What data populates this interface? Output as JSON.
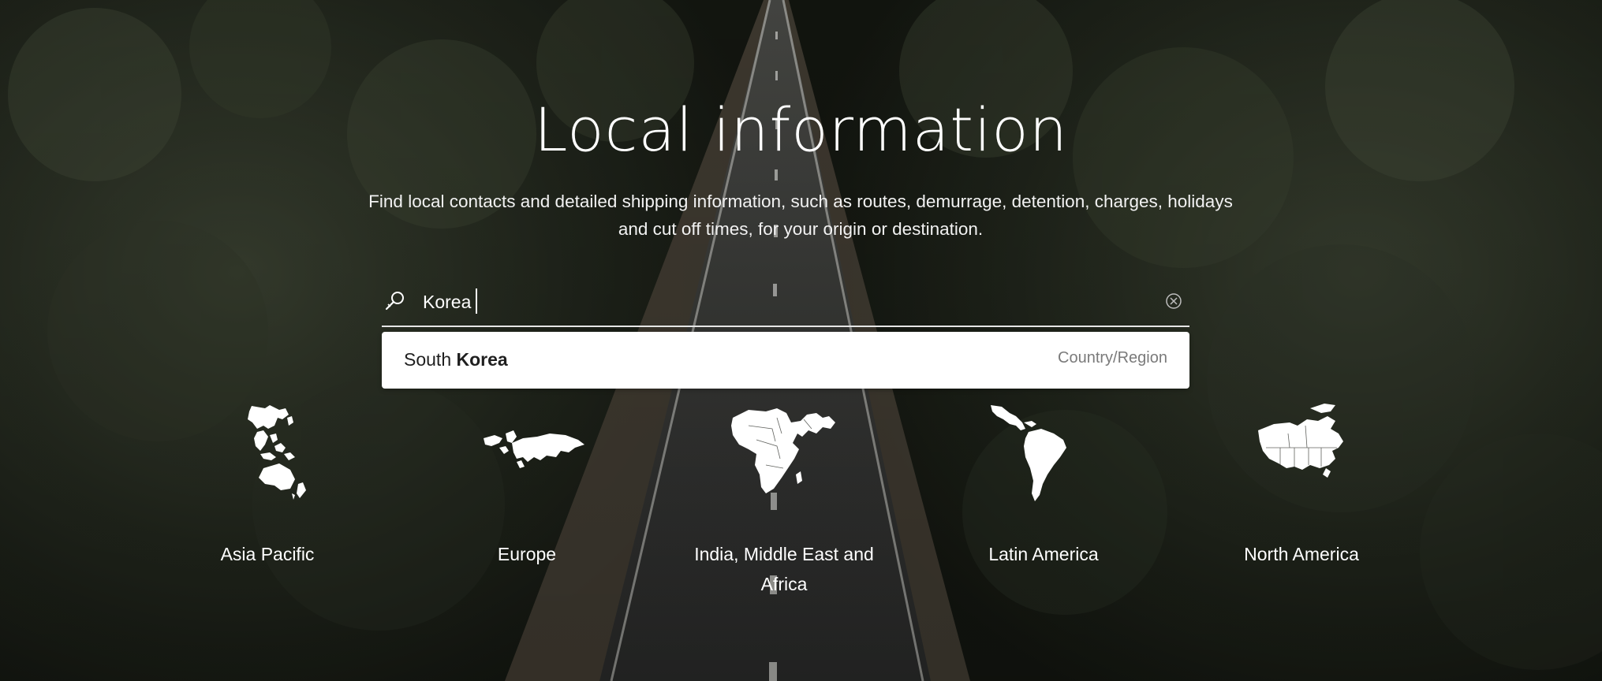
{
  "hero": {
    "title": "Local information",
    "subtitle": "Find local contacts and detailed shipping information, such as routes, demurrage, detention, charges, holidays and cut off times, for your origin or destination."
  },
  "search": {
    "value": "Korea",
    "placeholder": ""
  },
  "suggestion": {
    "name_prefix": "South ",
    "name_match": "Korea",
    "type": "Country/Region"
  },
  "regions": [
    {
      "label": "Asia Pacific",
      "icon": "asia-pacific-map-icon"
    },
    {
      "label": "Europe",
      "icon": "europe-map-icon"
    },
    {
      "label": "India, Middle East and Africa",
      "icon": "africa-map-icon"
    },
    {
      "label": "Latin America",
      "icon": "latin-america-map-icon"
    },
    {
      "label": "North America",
      "icon": "north-america-map-icon"
    }
  ],
  "colors": {
    "text": "#ffffff",
    "foliage": "#1d2019",
    "road": "#2b2d2c",
    "suggestion_bg": "#ffffff",
    "suggestion_meta": "#7a7a7a"
  }
}
